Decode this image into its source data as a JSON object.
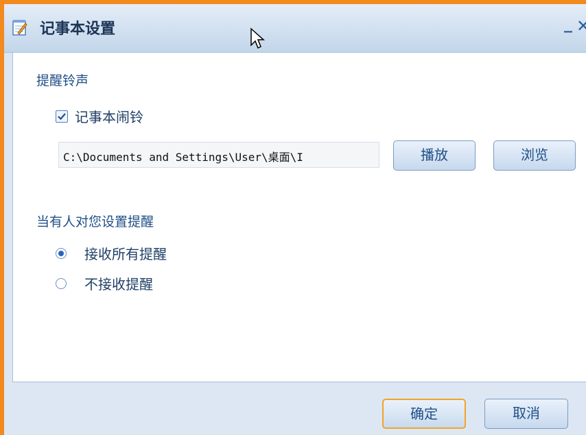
{
  "window": {
    "title": "记事本设置",
    "minimize_label": "_",
    "close_label": "✕"
  },
  "sound_section": {
    "title": "提醒铃声",
    "alarm_checkbox_label": "记事本闹铃",
    "alarm_checked": true,
    "path_value": "C:\\Documents and Settings\\User\\桌面\\I",
    "play_button": "播放",
    "browse_button": "浏览"
  },
  "remind_section": {
    "title": "当有人对您设置提醒",
    "options": [
      {
        "label": "接收所有提醒",
        "checked": true
      },
      {
        "label": "不接收提醒",
        "checked": false
      }
    ]
  },
  "footer": {
    "ok_button": "确定",
    "cancel_button": "取消"
  },
  "colors": {
    "accent_border": "#f28a1f",
    "title_text": "#1c3556",
    "label_text": "#1f4f86"
  }
}
